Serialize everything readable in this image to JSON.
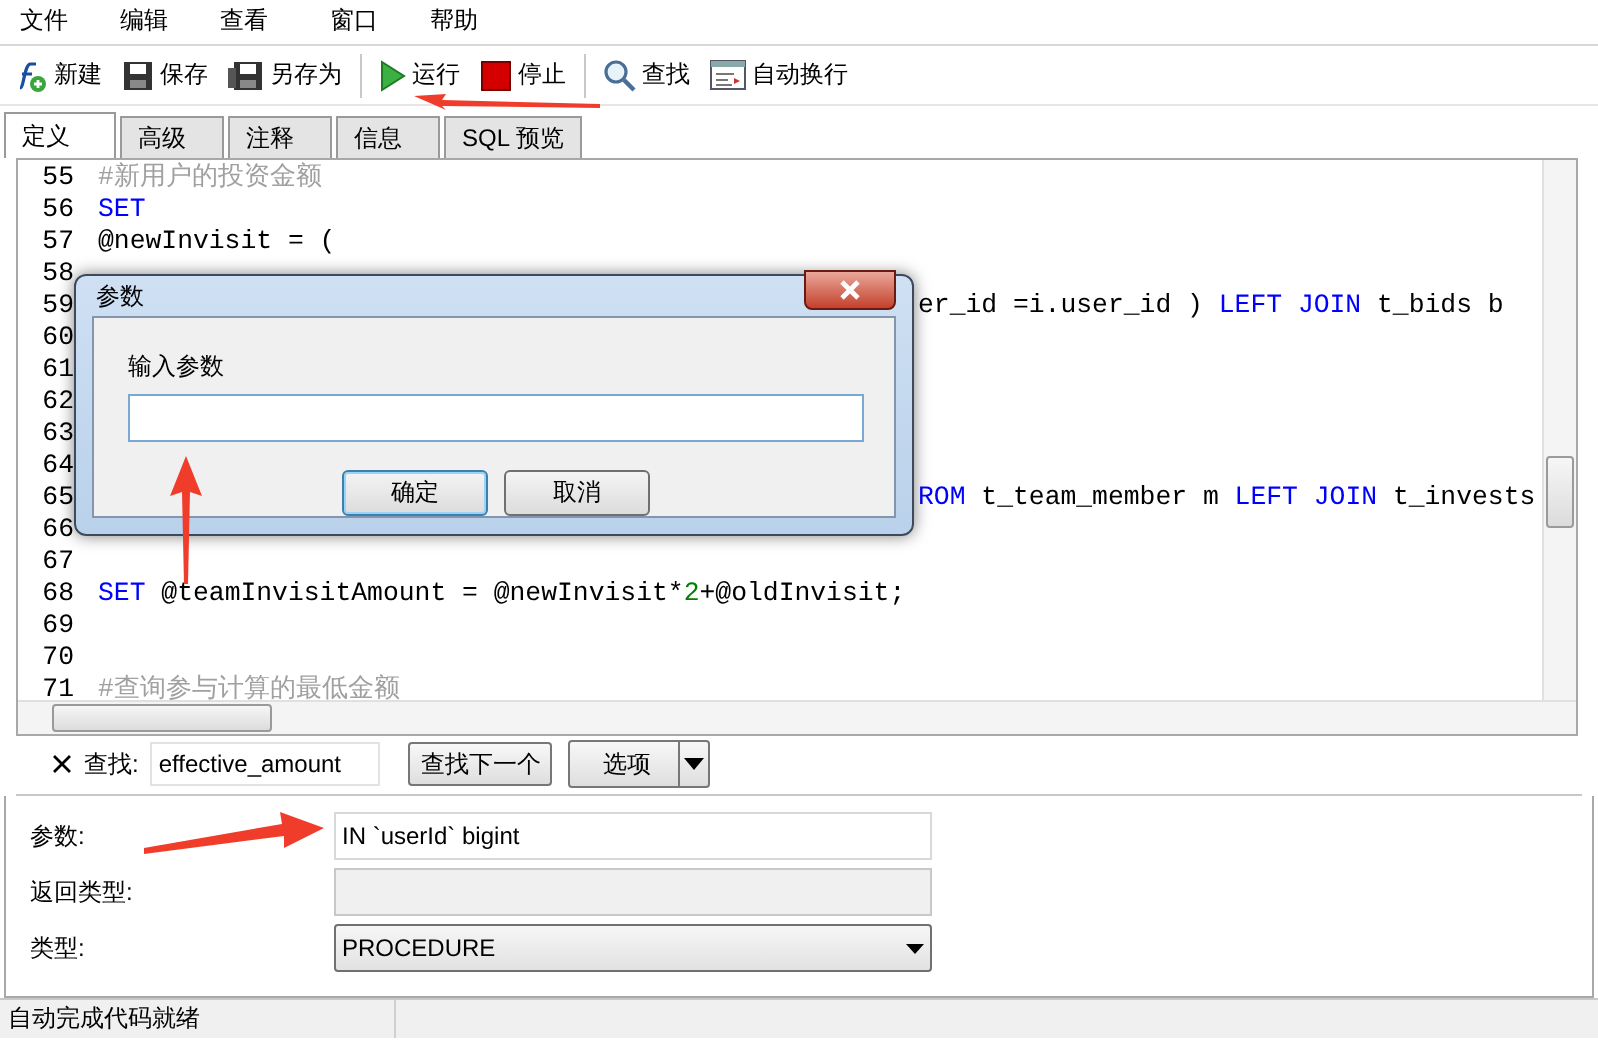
{
  "menu": [
    {
      "label": "文件"
    },
    {
      "label": "编辑"
    },
    {
      "label": "查看"
    },
    {
      "label": "窗口"
    },
    {
      "label": "帮助"
    }
  ],
  "toolbar_groups": [
    {
      "buttons": [
        {
          "kind": "new",
          "label": "新建"
        },
        {
          "kind": "save",
          "label": "保存"
        },
        {
          "kind": "save_as",
          "label": "另存为"
        }
      ]
    },
    {
      "buttons": [
        {
          "kind": "run",
          "label": "运行"
        },
        {
          "kind": "stop",
          "label": "停止"
        }
      ]
    },
    {
      "buttons": [
        {
          "kind": "find",
          "label": "查找"
        },
        {
          "kind": "wrap",
          "label": "自动换行"
        }
      ]
    }
  ],
  "tabs": [
    {
      "label": "定义",
      "selected": true
    },
    {
      "label": "高级",
      "selected": false
    },
    {
      "label": "注释",
      "selected": false
    },
    {
      "label": "信息",
      "selected": false
    },
    {
      "label": "SQL 预览",
      "selected": false
    }
  ],
  "editor": {
    "lines": [
      {
        "number": "55",
        "kind": "full",
        "tokens": [
          {
            "kind": "comment",
            "text": "#新用户的投资金额"
          }
        ]
      },
      {
        "number": "56",
        "kind": "full",
        "tokens": [
          {
            "kind": "keyword",
            "text": "SET"
          }
        ]
      },
      {
        "number": "57",
        "kind": "full",
        "tokens": [
          {
            "kind": "plain",
            "text": "@newInvisit = ("
          }
        ]
      },
      {
        "number": "58"
      },
      {
        "number": "59",
        "kind": "partial",
        "tokens": [
          {
            "kind": "plain",
            "text": "er_id =i.user_id ) "
          },
          {
            "kind": "keyword",
            "text": "LEFT JOIN"
          },
          {
            "kind": "plain",
            "text": " t_bids b"
          }
        ]
      },
      {
        "number": "60"
      },
      {
        "number": "61"
      },
      {
        "number": "62"
      },
      {
        "number": "63"
      },
      {
        "number": "64"
      },
      {
        "number": "65",
        "kind": "partial",
        "tokens": [
          {
            "kind": "keyword",
            "text": "ROM"
          },
          {
            "kind": "plain",
            "text": " t_team_member m "
          },
          {
            "kind": "keyword",
            "text": "LEFT JOIN"
          },
          {
            "kind": "plain",
            "text": " t_invests"
          }
        ]
      },
      {
        "number": "66"
      },
      {
        "number": "67"
      },
      {
        "number": "68",
        "kind": "full",
        "tokens": [
          {
            "kind": "keyword",
            "text": "SET"
          },
          {
            "kind": "plain",
            "text": " @teamInvisitAmount = @newInvisit*"
          },
          {
            "kind": "number",
            "text": "2"
          },
          {
            "kind": "plain",
            "text": "+@oldInvisit;"
          }
        ]
      },
      {
        "number": "69"
      },
      {
        "number": "70"
      },
      {
        "number": "71",
        "kind": "full",
        "tokens": [
          {
            "kind": "comment",
            "text": "#查询参与计算的最低金额"
          }
        ]
      }
    ]
  },
  "find_bar": {
    "label": "查找:",
    "value": "effective_amount",
    "next_button": "查找下一个",
    "options_button": "选项"
  },
  "form": {
    "fields": [
      {
        "label": "参数:",
        "kind": "text",
        "disabled": false,
        "value": "IN `userId` bigint"
      },
      {
        "label": "返回类型:",
        "kind": "text",
        "disabled": true
      },
      {
        "label": "类型:",
        "kind": "select",
        "disabled": false,
        "value": "PROCEDURE"
      }
    ]
  },
  "status_bar": {
    "text": "自动完成代码就绪"
  },
  "dialog": {
    "title": "参数",
    "label": "输入参数",
    "buttons": [
      {
        "label": "确定",
        "default": true
      },
      {
        "label": "取消",
        "default": false
      }
    ]
  }
}
